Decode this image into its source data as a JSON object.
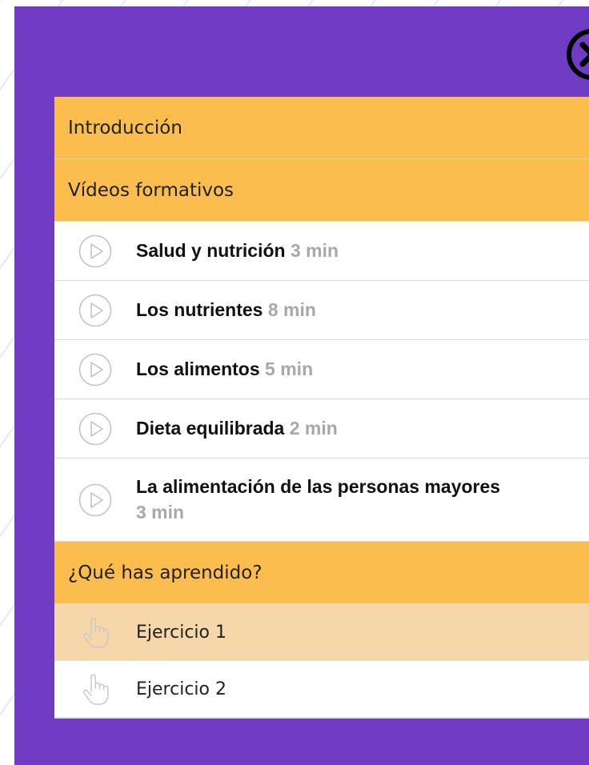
{
  "menu": {
    "sections": {
      "intro": "Introducción",
      "videos": "Vídeos formativos",
      "quiz": "¿Qué has aprendido?"
    },
    "videos": [
      {
        "title": "Salud y nutrición",
        "duration": "3 min"
      },
      {
        "title": "Los nutrientes",
        "duration": "8 min"
      },
      {
        "title": "Los alimentos",
        "duration": "5 min"
      },
      {
        "title": "Dieta equilibrada",
        "duration": "2 min"
      },
      {
        "title": "La alimentación de las personas mayores",
        "duration": "3 min"
      }
    ],
    "exercises": [
      {
        "label": "Ejercicio 1",
        "active": true
      },
      {
        "label": "Ejercicio 2",
        "active": false
      }
    ]
  },
  "icons": {
    "close": "close-icon",
    "video": "play-icon",
    "exercise": "pointer-hand-icon"
  },
  "colors": {
    "panel": "#6f3cc3",
    "section": "#fbbd4e",
    "exercise_active": "#f6d7aa",
    "duration": "#a8a8a8"
  }
}
